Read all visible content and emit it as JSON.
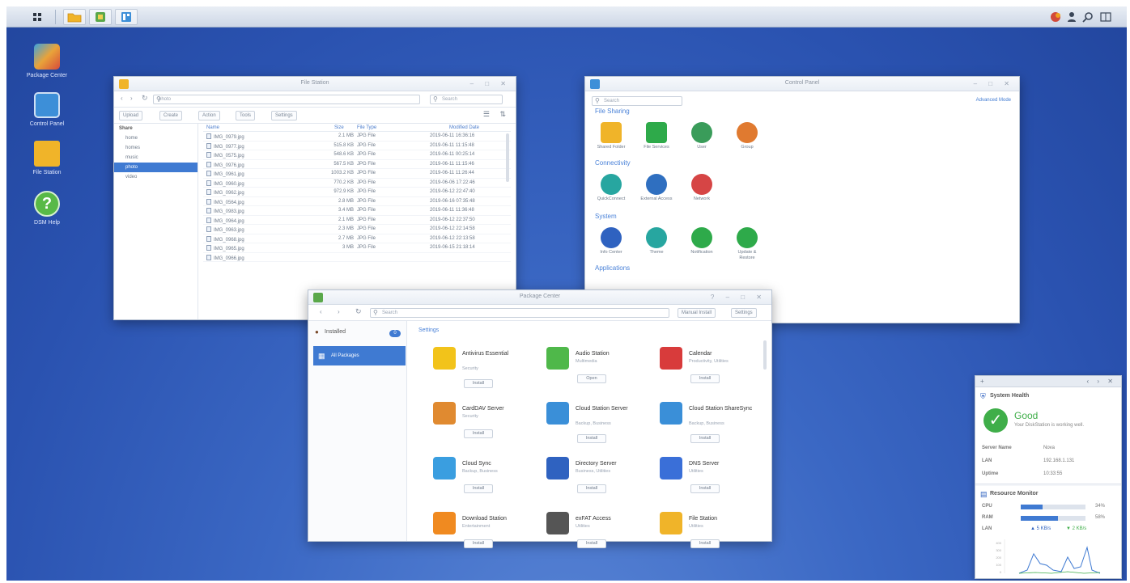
{
  "taskbar": {
    "left_buttons": [
      "main-menu",
      "file-station",
      "package-center",
      "control-panel"
    ],
    "right_icons": [
      "notifications-icon",
      "user-icon",
      "search-icon",
      "widgets-icon"
    ]
  },
  "desktop_icons": [
    {
      "label": "Package Center",
      "icon": "package-center-icon",
      "color": "#e9a33a"
    },
    {
      "label": "Control Panel",
      "icon": "control-panel-icon",
      "color": "#3d8fd8"
    },
    {
      "label": "File Station",
      "icon": "file-station-icon",
      "color": "#f0b429"
    },
    {
      "label": "DSM Help",
      "icon": "help-icon",
      "color": "#58b947"
    }
  ],
  "file_station": {
    "title": "File Station",
    "path": "photo",
    "search_placeholder": "Search",
    "toolbar": [
      "Upload",
      "Create",
      "Action",
      "Tools",
      "Settings"
    ],
    "tree": {
      "root": "Share",
      "items": [
        "home",
        "homes",
        "music",
        "photo",
        "video"
      ],
      "selected": 3
    },
    "columns": [
      "Name",
      "Size",
      "File Type",
      "Modified Date"
    ],
    "rows": [
      [
        "IMG_0979.jpg",
        "2.1 MB",
        "JPG File",
        "2019-06-11 16:36:16"
      ],
      [
        "IMG_0977.jpg",
        "515.8 KB",
        "JPG File",
        "2019-06-11 11:15:48"
      ],
      [
        "IMG_0575.jpg",
        "548.6 KB",
        "JPG File",
        "2019-06-11 00:25:14"
      ],
      [
        "IMG_0976.jpg",
        "567.5 KB",
        "JPG File",
        "2019-06-11 11:15:46"
      ],
      [
        "IMG_0961.jpg",
        "1003.2 KB",
        "JPG File",
        "2019-06-11 11:26:44"
      ],
      [
        "IMG_0960.jpg",
        "770.2 KB",
        "JPG File",
        "2019-06-06 17:22:46"
      ],
      [
        "IMG_0962.jpg",
        "972.9 KB",
        "JPG File",
        "2019-06-12 22:47:40"
      ],
      [
        "IMG_0564.jpg",
        "2.8 MB",
        "JPG File",
        "2019-06-16 07:35:48"
      ],
      [
        "IMG_0983.jpg",
        "3.4 MB",
        "JPG File",
        "2019-06-11 11:36:48"
      ],
      [
        "IMG_0964.jpg",
        "2.1 MB",
        "JPG File",
        "2019-06-12 22:37:50"
      ],
      [
        "IMG_0963.jpg",
        "2.3 MB",
        "JPG File",
        "2019-06-12 22:14:58"
      ],
      [
        "IMG_0968.jpg",
        "2.7 MB",
        "JPG File",
        "2019-06-12 22:13:58"
      ],
      [
        "IMG_0965.jpg",
        "3 MB",
        "JPG File",
        "2019-06-15 21:18:14"
      ],
      [
        "IMG_0966.jpg",
        "",
        "",
        ""
      ]
    ]
  },
  "control_panel": {
    "title": "Control Panel",
    "search_placeholder": "Search",
    "advanced_mode": "Advanced Mode",
    "sections": [
      {
        "name": "File Sharing",
        "items": [
          {
            "label": "Shared Folder",
            "color": "#f0b429"
          },
          {
            "label": "File Services",
            "color": "#2eaa4a"
          },
          {
            "label": "User",
            "color": "#3a9c5a"
          },
          {
            "label": "Group",
            "color": "#e07a30"
          }
        ]
      },
      {
        "name": "Connectivity",
        "items": [
          {
            "label": "QuickConnect",
            "color": "#27a6a0"
          },
          {
            "label": "External Access",
            "color": "#2f6fc0"
          },
          {
            "label": "Network",
            "color": "#d64545"
          }
        ]
      },
      {
        "name": "System",
        "items": [
          {
            "label": "Info Center",
            "color": "#2f62c0"
          },
          {
            "label": "Theme",
            "color": "#27a6a0"
          },
          {
            "label": "Notification",
            "color": "#2eaa4a"
          },
          {
            "label": "Update & Restore",
            "color": "#2eaa4a"
          }
        ]
      },
      {
        "name": "Applications",
        "items": []
      }
    ]
  },
  "package_center": {
    "title": "Package Center",
    "search_placeholder": "Search",
    "manual_install": "Manual Install",
    "settings": "Settings",
    "installed_label": "Installed",
    "installed_count": "0",
    "all_packages": "All Packages",
    "section": "Settings",
    "packages": [
      {
        "name": "Antivirus Essential",
        "category": "Security",
        "button": "Install",
        "color": "#f2c31a"
      },
      {
        "name": "Audio Station",
        "category": "Multimedia",
        "button": "Open",
        "color": "#4fb84a"
      },
      {
        "name": "Calendar",
        "category": "Productivity, Utilities",
        "button": "Install",
        "color": "#d83b3b"
      },
      {
        "name": "CardDAV Server",
        "category": "Security",
        "button": "Install",
        "color": "#e08a30"
      },
      {
        "name": "Cloud Station Server",
        "category": "Backup, Business",
        "button": "Install",
        "color": "#3a8fd8"
      },
      {
        "name": "Cloud Station ShareSync",
        "category": "Backup, Business",
        "button": "Install",
        "color": "#3a8fd8"
      },
      {
        "name": "Cloud Sync",
        "category": "Backup, Business",
        "button": "Install",
        "color": "#3a9ee0"
      },
      {
        "name": "Directory Server",
        "category": "Business, Utilities",
        "button": "Install",
        "color": "#2f62c0"
      },
      {
        "name": "DNS Server",
        "category": "Utilities",
        "button": "Install",
        "color": "#3a6fd8"
      },
      {
        "name": "Download Station",
        "category": "Entertainment",
        "button": "Install",
        "color": "#f08a20"
      },
      {
        "name": "exFAT Access",
        "category": "Utilities",
        "button": "Install",
        "color": "#555555"
      },
      {
        "name": "File Station",
        "category": "Utilities",
        "button": "Install",
        "color": "#f0b429"
      }
    ]
  },
  "widget": {
    "system_health": {
      "title": "System Health",
      "status": "Good",
      "message": "Your DiskStation is working well.",
      "rows": [
        {
          "label": "Server Name",
          "value": "Nova"
        },
        {
          "label": "LAN",
          "value": "192.168.1.131"
        },
        {
          "label": "Uptime",
          "value": "10:33:55"
        }
      ]
    },
    "resource_monitor": {
      "title": "Resource Monitor",
      "rows": [
        {
          "label": "CPU",
          "value": "34%",
          "percent": 34
        },
        {
          "label": "RAM",
          "value": "58%",
          "percent": 58
        }
      ],
      "lan_label": "LAN",
      "lan_up": "▲ 5 KB/s",
      "lan_down": "▼ 2 KB/s",
      "chart_ticks": [
        "400",
        "300",
        "200",
        "100",
        "0"
      ]
    }
  }
}
